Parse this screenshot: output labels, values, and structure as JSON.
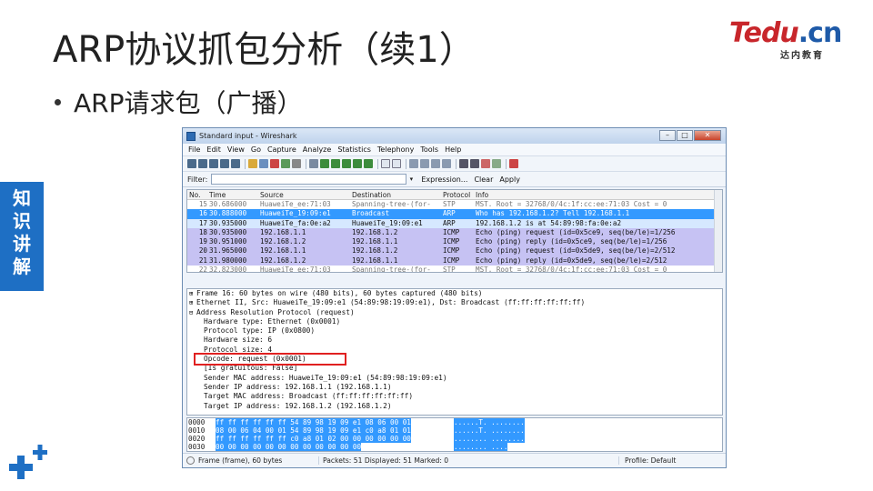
{
  "slide": {
    "title": "ARP协议抓包分析（续1）",
    "bullet": "ARP请求包（广播）",
    "logo_main_a": "Tedu",
    "logo_main_b": ".cn",
    "logo_sub": "达内教育",
    "side_tab": "知识讲解"
  },
  "window": {
    "title": "Standard input - Wireshark",
    "controls": [
      "–",
      "□",
      "✕"
    ]
  },
  "menu": [
    "File",
    "Edit",
    "View",
    "Go",
    "Capture",
    "Analyze",
    "Statistics",
    "Telephony",
    "Tools",
    "Help"
  ],
  "filter": {
    "label": "Filter:",
    "value": "",
    "expression": "Expression...",
    "clear": "Clear",
    "apply": "Apply"
  },
  "packet_list": {
    "columns": [
      "No.",
      "Time",
      "Source",
      "Destination",
      "Protocol",
      "Info"
    ],
    "rows": [
      {
        "no": "15",
        "time": "30.686000",
        "src": "HuaweiTe_ee:71:03",
        "dst": "Spanning-tree-(for-",
        "proto": "STP",
        "info": "MST. Root = 32768/0/4c:1f:cc:ee:71:03  Cost = 0",
        "bg": "#ffffff",
        "fg": "#777777"
      },
      {
        "no": "16",
        "time": "30.888000",
        "src": "HuaweiTe_19:09:e1",
        "dst": "Broadcast",
        "proto": "ARP",
        "info": "Who has 192.168.1.2?  Tell 192.168.1.1",
        "bg": "#3399ff",
        "fg": "#ffffff"
      },
      {
        "no": "17",
        "time": "30.935000",
        "src": "HuaweiTe_fa:0e:a2",
        "dst": "HuaweiTe_19:09:e1",
        "proto": "ARP",
        "info": "192.168.1.2 is at 54:89:98:fa:0e:a2",
        "bg": "#d6e8ff",
        "fg": "#111111"
      },
      {
        "no": "18",
        "time": "30.935000",
        "src": "192.168.1.1",
        "dst": "192.168.1.2",
        "proto": "ICMP",
        "info": "Echo (ping) request  (id=0x5ce9, seq(be/le)=1/256",
        "bg": "#c6c2f3",
        "fg": "#111111"
      },
      {
        "no": "19",
        "time": "30.951000",
        "src": "192.168.1.2",
        "dst": "192.168.1.1",
        "proto": "ICMP",
        "info": "Echo (ping) reply    (id=0x5ce9, seq(be/le)=1/256",
        "bg": "#c6c2f3",
        "fg": "#111111"
      },
      {
        "no": "20",
        "time": "31.965000",
        "src": "192.168.1.1",
        "dst": "192.168.1.2",
        "proto": "ICMP",
        "info": "Echo (ping) request  (id=0x5de9, seq(be/le)=2/512",
        "bg": "#c6c2f3",
        "fg": "#111111"
      },
      {
        "no": "21",
        "time": "31.980000",
        "src": "192.168.1.2",
        "dst": "192.168.1.1",
        "proto": "ICMP",
        "info": "Echo (ping) reply    (id=0x5de9, seq(be/le)=2/512",
        "bg": "#c6c2f3",
        "fg": "#111111"
      },
      {
        "no": "22",
        "time": "32.823000",
        "src": "HuaweiTe_ee:71:03",
        "dst": "Spanning-tree-(for-",
        "proto": "STP",
        "info": "MST. Root = 32768/0/4c:1f:cc:ee:71:03  Cost = 0",
        "bg": "#ffffff",
        "fg": "#777777"
      }
    ]
  },
  "details": [
    {
      "level": 0,
      "mark": "⊞",
      "text": "Frame 16: 60 bytes on wire (480 bits), 60 bytes captured (480 bits)"
    },
    {
      "level": 0,
      "mark": "⊞",
      "text": "Ethernet II, Src: HuaweiTe_19:09:e1 (54:89:98:19:09:e1), Dst: Broadcast (ff:ff:ff:ff:ff:ff)"
    },
    {
      "level": 0,
      "mark": "⊟",
      "text": "Address Resolution Protocol (request)"
    },
    {
      "level": 1,
      "mark": "",
      "text": "Hardware type: Ethernet (0x0001)"
    },
    {
      "level": 1,
      "mark": "",
      "text": "Protocol type: IP (0x0800)"
    },
    {
      "level": 1,
      "mark": "",
      "text": "Hardware size: 6"
    },
    {
      "level": 1,
      "mark": "",
      "text": "Protocol size: 4"
    },
    {
      "level": 1,
      "mark": "",
      "text": "Opcode: request (0x0001)"
    },
    {
      "level": 1,
      "mark": "",
      "text": "[Is gratuitous: False]"
    },
    {
      "level": 1,
      "mark": "",
      "text": "Sender MAC address: HuaweiTe_19:09:e1 (54:89:98:19:09:e1)"
    },
    {
      "level": 1,
      "mark": "",
      "text": "Sender IP address: 192.168.1.1 (192.168.1.1)"
    },
    {
      "level": 1,
      "mark": "",
      "text": "Target MAC address: Broadcast (ff:ff:ff:ff:ff:ff)"
    },
    {
      "level": 1,
      "mark": "",
      "text": "Target IP address: 192.168.1.2 (192.168.1.2)"
    }
  ],
  "hex": [
    {
      "offset": "0000",
      "bytes": "ff ff ff ff ff ff 54 89  98 19 09 e1 08 06 00 01",
      "ascii": "......T. ........"
    },
    {
      "offset": "0010",
      "bytes": "08 00 06 04 00 01 54 89  98 19 09 e1 c0 a8 01 01",
      "ascii": "......T. ........"
    },
    {
      "offset": "0020",
      "bytes": "ff ff ff ff ff ff c0 a8  01 02 00 00 00 00 00 00",
      "ascii": "........ ........"
    },
    {
      "offset": "0030",
      "bytes": "00 00 00 00 00 00 00 00  00 00 00 00",
      "ascii": "........ ...."
    }
  ],
  "status": {
    "frame": "Frame (frame), 60 bytes",
    "packets": "Packets: 51 Displayed: 51 Marked: 0",
    "profile": "Profile: Default"
  },
  "colors": {
    "accent_blue": "#1e6fc4",
    "selection": "#3399ff",
    "icmp_row": "#c6c2f3",
    "highlight_box": "#e02020"
  }
}
